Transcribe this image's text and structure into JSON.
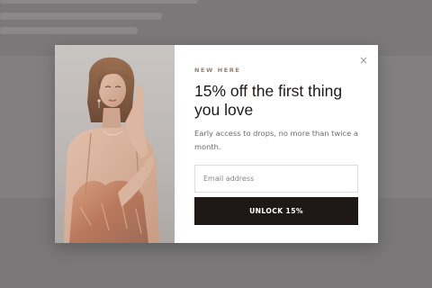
{
  "modal": {
    "eyebrow": "NEW HERE",
    "headline": "15% off the first thing you love",
    "subtext": "Early access to drops, no more than twice a month.",
    "email_placeholder": "Email address",
    "cta_label": "UNLOCK 15%",
    "close_glyph": "×",
    "image_alt": "Model with hand on face wearing sequin top"
  },
  "colors": {
    "overlay": "#7a7878",
    "cta_background": "#1e1916",
    "eyebrow": "#8f7f72",
    "headline": "#1d1b1a"
  }
}
